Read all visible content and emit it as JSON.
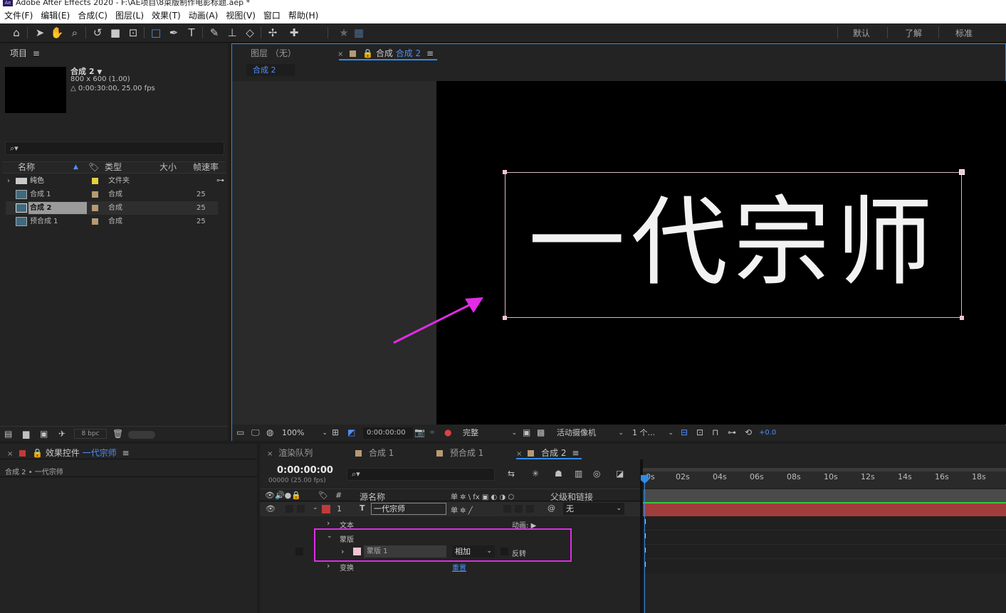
{
  "app": {
    "title": "Adobe After Effects 2020 - F:\\AE项目\\8菜版制作电影标题.aep *",
    "logo_text": "Ae"
  },
  "menu": [
    "文件(F)",
    "编辑(E)",
    "合成(C)",
    "图层(L)",
    "效果(T)",
    "动画(A)",
    "视图(V)",
    "窗口",
    "帮助(H)"
  ],
  "workspaces": [
    "默认",
    "了解",
    "标准"
  ],
  "project": {
    "tab_label": "项目",
    "comp_name": "合成 2",
    "comp_size": "800 x 600 (1.00)",
    "comp_duration": "△ 0:00:30:00, 25.00 fps",
    "search_placeholder": "",
    "columns": {
      "name": "名称",
      "type": "类型",
      "size": "大小",
      "fps": "帧速率"
    },
    "items": [
      {
        "name": "纯色",
        "type": "文件夹",
        "fps": "",
        "color": "#e6cf3c",
        "icon": "folder-icon"
      },
      {
        "name": "合成 1",
        "type": "合成",
        "fps": "25",
        "color": "#b59a73",
        "icon": "composition-icon"
      },
      {
        "name": "合成 2",
        "type": "合成",
        "fps": "25",
        "color": "#b59a73",
        "icon": "composition-icon",
        "selected": true
      },
      {
        "name": "预合成 1",
        "type": "合成",
        "fps": "25",
        "color": "#b59a73",
        "icon": "composition-icon"
      }
    ],
    "bpc": "8 bpc"
  },
  "viewer": {
    "layer_tab": "图层 （无）",
    "comp_tab_prefix": "合成",
    "comp_tab_name": "合成 2",
    "breadcrumb": "合成 2",
    "title_text": "一代宗师",
    "zoom": "100%",
    "timecode": "0:00:00:00",
    "resolution": "完整",
    "camera": "活动摄像机",
    "views": "1 个...",
    "exposure": "+0.0"
  },
  "effects": {
    "tab_prefix": "效果控件",
    "tab_layer": "一代宗师",
    "breadcrumb": "合成 2 • 一代宗师"
  },
  "timeline": {
    "tabs": [
      "渲染队列",
      "合成 1",
      "预合成 1",
      "合成 2"
    ],
    "timecode": "0:00:00:00",
    "frame_info": "00000 (25.00 fps)",
    "columns": {
      "hash": "#",
      "source": "源名称",
      "switches": "单 ✲ \\ fx ▣ ◐ ◑ ⬡",
      "parent": "父级和链接"
    },
    "layer": {
      "index": "1",
      "type_icon": "T",
      "name": "一代宗师",
      "parent": "无",
      "color": "#c03a3a"
    },
    "text_group": "文本",
    "animate_label": "动画:",
    "mask_group": "蒙版",
    "mask": {
      "name": "蒙版 1",
      "mode": "相加",
      "invert": "反转",
      "color": "#f5c3d3"
    },
    "transform_group": "变换",
    "reset_label": "重置",
    "ruler": [
      "0s",
      "02s",
      "04s",
      "06s",
      "08s",
      "10s",
      "12s",
      "14s",
      "16s",
      "18s"
    ]
  },
  "colors": {
    "accent": "#2d8ceb",
    "annotation": "#e02ce6",
    "layer_bar": "#a13c3c"
  }
}
